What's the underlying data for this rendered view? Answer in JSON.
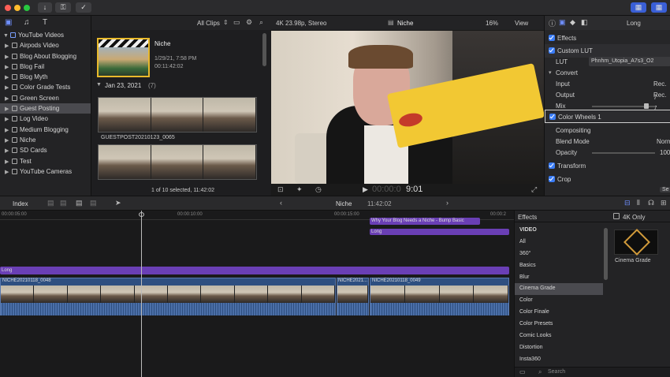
{
  "titlebar": {
    "buttons": [
      "↓",
      "⚿",
      "✓"
    ]
  },
  "library": {
    "root": "YouTube Videos",
    "items": [
      {
        "label": "Airpods Video",
        "selected": false
      },
      {
        "label": "Blog About Blogging",
        "selected": false
      },
      {
        "label": "Blog Fail",
        "selected": false
      },
      {
        "label": "Blog Myth",
        "selected": false
      },
      {
        "label": "Color Grade Tests",
        "selected": false
      },
      {
        "label": "Green Screen",
        "selected": false
      },
      {
        "label": "Guest Posting",
        "selected": true
      },
      {
        "label": "Log Video",
        "selected": false
      },
      {
        "label": "Medium Blogging",
        "selected": false
      },
      {
        "label": "Niche",
        "selected": false
      },
      {
        "label": "SD Cards",
        "selected": false
      },
      {
        "label": "Test",
        "selected": false
      },
      {
        "label": "YouTube Cameras",
        "selected": false
      }
    ]
  },
  "browser": {
    "filter": "All Clips",
    "project_name": "Niche",
    "project_date": "1/29/21, 7:58 PM",
    "project_duration": "00:11:42:02",
    "date_group": "Jan 23, 2021",
    "date_count": "(7)",
    "clip_name": "GUESTPOST20210123_0065",
    "status": "1 of 10 selected, 11:42:02"
  },
  "viewer": {
    "format": "4K 23.98p, Stereo",
    "title": "Niche",
    "zoom": "16%",
    "view_menu": "View",
    "timecode_dim": "00:00:0",
    "timecode_bright": "9:01"
  },
  "inspector": {
    "header": "Long",
    "effects_label": "Effects",
    "custom_lut": "Custom LUT",
    "lut_label": "LUT",
    "lut_value": "Phnhm_Utopia_A7s3_O2",
    "convert": "Convert",
    "input_label": "Input",
    "input_value": "Rec. 7",
    "output_label": "Output",
    "output_value": "Rec. 7",
    "mix_label": "Mix",
    "color_wheels": "Color Wheels 1",
    "compositing": "Compositing",
    "blend_label": "Blend Mode",
    "blend_value": "Norm",
    "opacity_label": "Opacity",
    "opacity_value": "100",
    "transform": "Transform",
    "crop": "Crop",
    "save_label": "Se"
  },
  "timebar": {
    "index": "Index",
    "project": "Niche",
    "duration": "11:42:02"
  },
  "timeline": {
    "ruler": [
      "00:00:05:00",
      "00:00:10:00",
      "00:00:15:00",
      "00:00:2"
    ],
    "title_clip": "Why Your Blog Needs a Niche - Bump Basic",
    "long_clip_top": "Long",
    "long_clip_main": "Long",
    "clip_a": "NICHE20210118_0048",
    "clip_b": "NICHE2021...",
    "clip_c": "NICHE20210118_0049"
  },
  "effects": {
    "header": "Effects",
    "filter": "4K Only",
    "categories": [
      "VIDEO",
      "All",
      "360°",
      "Basics",
      "Blur",
      "Cinema Grade",
      "Color",
      "Color Finale",
      "Color Presets",
      "Comic Looks",
      "Distortion",
      "Insta360"
    ],
    "selected": "Cinema Grade",
    "item_name": "Cinema Grade",
    "search_placeholder": "Search"
  },
  "colors": {
    "accent": "#3a7cf6",
    "purple": "#6a3fb5",
    "clip_blue": "#2e4f80"
  }
}
